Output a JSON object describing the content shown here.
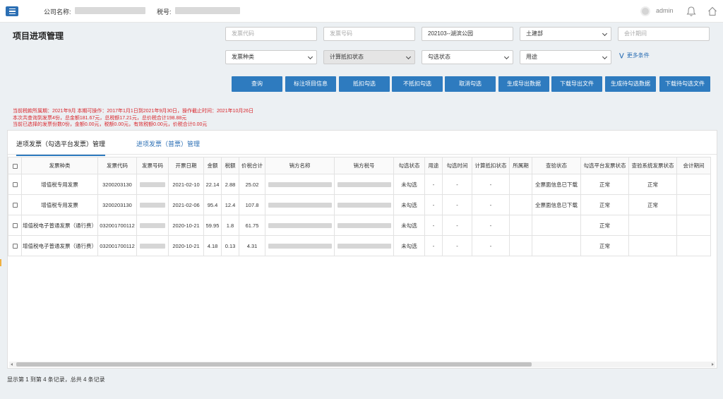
{
  "header": {
    "company_label": "公司名称:",
    "tax_label": "税号:",
    "user": "admin"
  },
  "page": {
    "title": "项目进项管理"
  },
  "filters": {
    "invoice_code_placeholder": "发票代码",
    "invoice_number_placeholder": "发票号码",
    "project_value": "202103--湖滨公园",
    "department_value": "土建部",
    "accounting_period_placeholder": "会计期间",
    "invoice_type_value": "发票种类",
    "deduction_status_value": "计算抵扣状态",
    "check_status_value": "勾选状态",
    "usage_value": "用途",
    "more_label": "更多条件"
  },
  "buttons": {
    "query": "查询",
    "mark_project": "标注项目信息",
    "deduct_check": "抵扣勾选",
    "no_deduct_check": "不抵扣勾选",
    "cancel_check": "取消勾选",
    "generate_export": "生成导出数据",
    "download_export": "下载导出文件",
    "generate_pending": "生成待勾选数据",
    "download_pending": "下载待勾选文件"
  },
  "info_lines": [
    "当前税款所属期：2021年9月 本期可操作：2017年1月1日到2021年9月30日，操作截止时间：2021年10月26日",
    "本次共查询到发票4份，总金额181.67元，总税额17.21元，总价税合计198.88元",
    "当前已选择的发票份数0份，金额0.00元，税额0.00元，有效税额0.00元，价税合计0.00元"
  ],
  "tabs": {
    "tab1": "进项发票（勾选平台发票）管理",
    "tab2": "进项发票（普票）管理"
  },
  "table": {
    "headers": [
      "发票种类",
      "发票代码",
      "发票号码",
      "开票日期",
      "金额",
      "税额",
      "价税合计",
      "销方名称",
      "销方税号",
      "勾选状态",
      "用途",
      "勾选时间",
      "计算抵扣状态",
      "所属期",
      "查验状态",
      "勾选平台发票状态",
      "查验系统发票状态",
      "会计期间"
    ],
    "rows": [
      {
        "type": "增值税专用发票",
        "code": "3200203130",
        "date": "2021-02-10",
        "amount": "22.14",
        "tax": "2.88",
        "total": "25.02",
        "check_status": "未勾选",
        "usage": "-",
        "check_time": "-",
        "deduct_status": "-",
        "period": "",
        "verify_status": "全票面信息已下载",
        "platform_status": "正常",
        "system_status": "正常"
      },
      {
        "type": "增值税专用发票",
        "code": "3200203130",
        "date": "2021-02-06",
        "amount": "95.4",
        "tax": "12.4",
        "total": "107.8",
        "check_status": "未勾选",
        "usage": "-",
        "check_time": "-",
        "deduct_status": "-",
        "period": "",
        "verify_status": "全票面信息已下载",
        "platform_status": "正常",
        "system_status": "正常"
      },
      {
        "type": "增值税电子普通发票（通行费）",
        "code": "032001700112",
        "date": "2020-10-21",
        "amount": "59.95",
        "tax": "1.8",
        "total": "61.75",
        "check_status": "未勾选",
        "usage": "-",
        "check_time": "-",
        "deduct_status": "-",
        "period": "",
        "verify_status": "",
        "platform_status": "正常",
        "system_status": ""
      },
      {
        "type": "增值税电子普通发票（通行费）",
        "code": "032001700112",
        "date": "2020-10-21",
        "amount": "4.18",
        "tax": "0.13",
        "total": "4.31",
        "check_status": "未勾选",
        "usage": "-",
        "check_time": "-",
        "deduct_status": "-",
        "period": "",
        "verify_status": "",
        "platform_status": "正常",
        "system_status": ""
      }
    ]
  },
  "footer": {
    "text": "显示第 1 到第 4 条记录，总共 4 条记录"
  },
  "colors": {
    "primary": "#2e7bbf",
    "alert": "#d9262c"
  }
}
